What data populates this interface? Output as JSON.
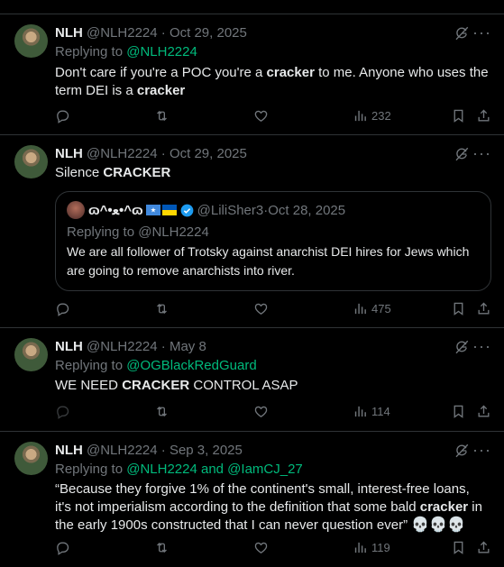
{
  "tweets": [
    {
      "name": "NLH",
      "handle": "@NLH2224",
      "sep": " · ",
      "date": "Oct 29, 2025",
      "replying_prefix": "Replying to ",
      "replying_to": "@NLH2224",
      "text_parts": [
        "Don't care if you're a POC you're a ",
        "cracker",
        " to me. Anyone who uses the",
        "term DEI is a ",
        "cracker"
      ],
      "views": "232"
    },
    {
      "name": "NLH",
      "handle": "@NLH2224",
      "sep": " · ",
      "date": "Oct 29, 2025",
      "text_parts": [
        "Silence ",
        "CRACKER"
      ],
      "quote": {
        "name": "ɷ^•ﻌ•^ɷ",
        "handle": "@LiliSher3",
        "sep": " · ",
        "date": "Oct 28, 2025",
        "replying": "Replying to @NLH2224",
        "text": "We are all follower of Trotsky against anarchist DEI hires for Jews which are going to remove anarchists into river."
      },
      "views": "475"
    },
    {
      "name": "NLH",
      "handle": "@NLH2224",
      "sep": " · ",
      "date": "May 8",
      "replying_prefix": "Replying to ",
      "replying_to": "@OGBlackRedGuard",
      "text_parts": [
        "WE NEED ",
        "CRACKER",
        " CONTROL ASAP"
      ],
      "views": "114"
    },
    {
      "name": "NLH",
      "handle": "@NLH2224",
      "sep": " · ",
      "date": "Sep 3, 2025",
      "replying_prefix": "Replying to ",
      "replying_to": "@NLH2224 and @IamCJ_27",
      "text_parts": [
        "“Because they forgive 1% of the continent's small, interest-free loans, it's not imperialism according to the definition that some bald ",
        "cracker",
        " in the early 1900s constructed that I can never question ever”"
      ],
      "skulls": "💀💀💀",
      "views": "119"
    }
  ],
  "more_glyph": "···",
  "colors": {
    "background": "#000000",
    "text": "#e7e9ea",
    "muted": "#71767b",
    "mention_blue": "#1d9bf0",
    "mention_green": "#00ba7c",
    "border": "#2f3336"
  },
  "icons": [
    "grok-icon",
    "more-icon",
    "reply-icon",
    "retweet-icon",
    "like-icon",
    "views-icon",
    "bookmark-icon",
    "share-icon",
    "verified-badge-icon",
    "somalia-flag-icon",
    "ukraine-flag-icon"
  ]
}
